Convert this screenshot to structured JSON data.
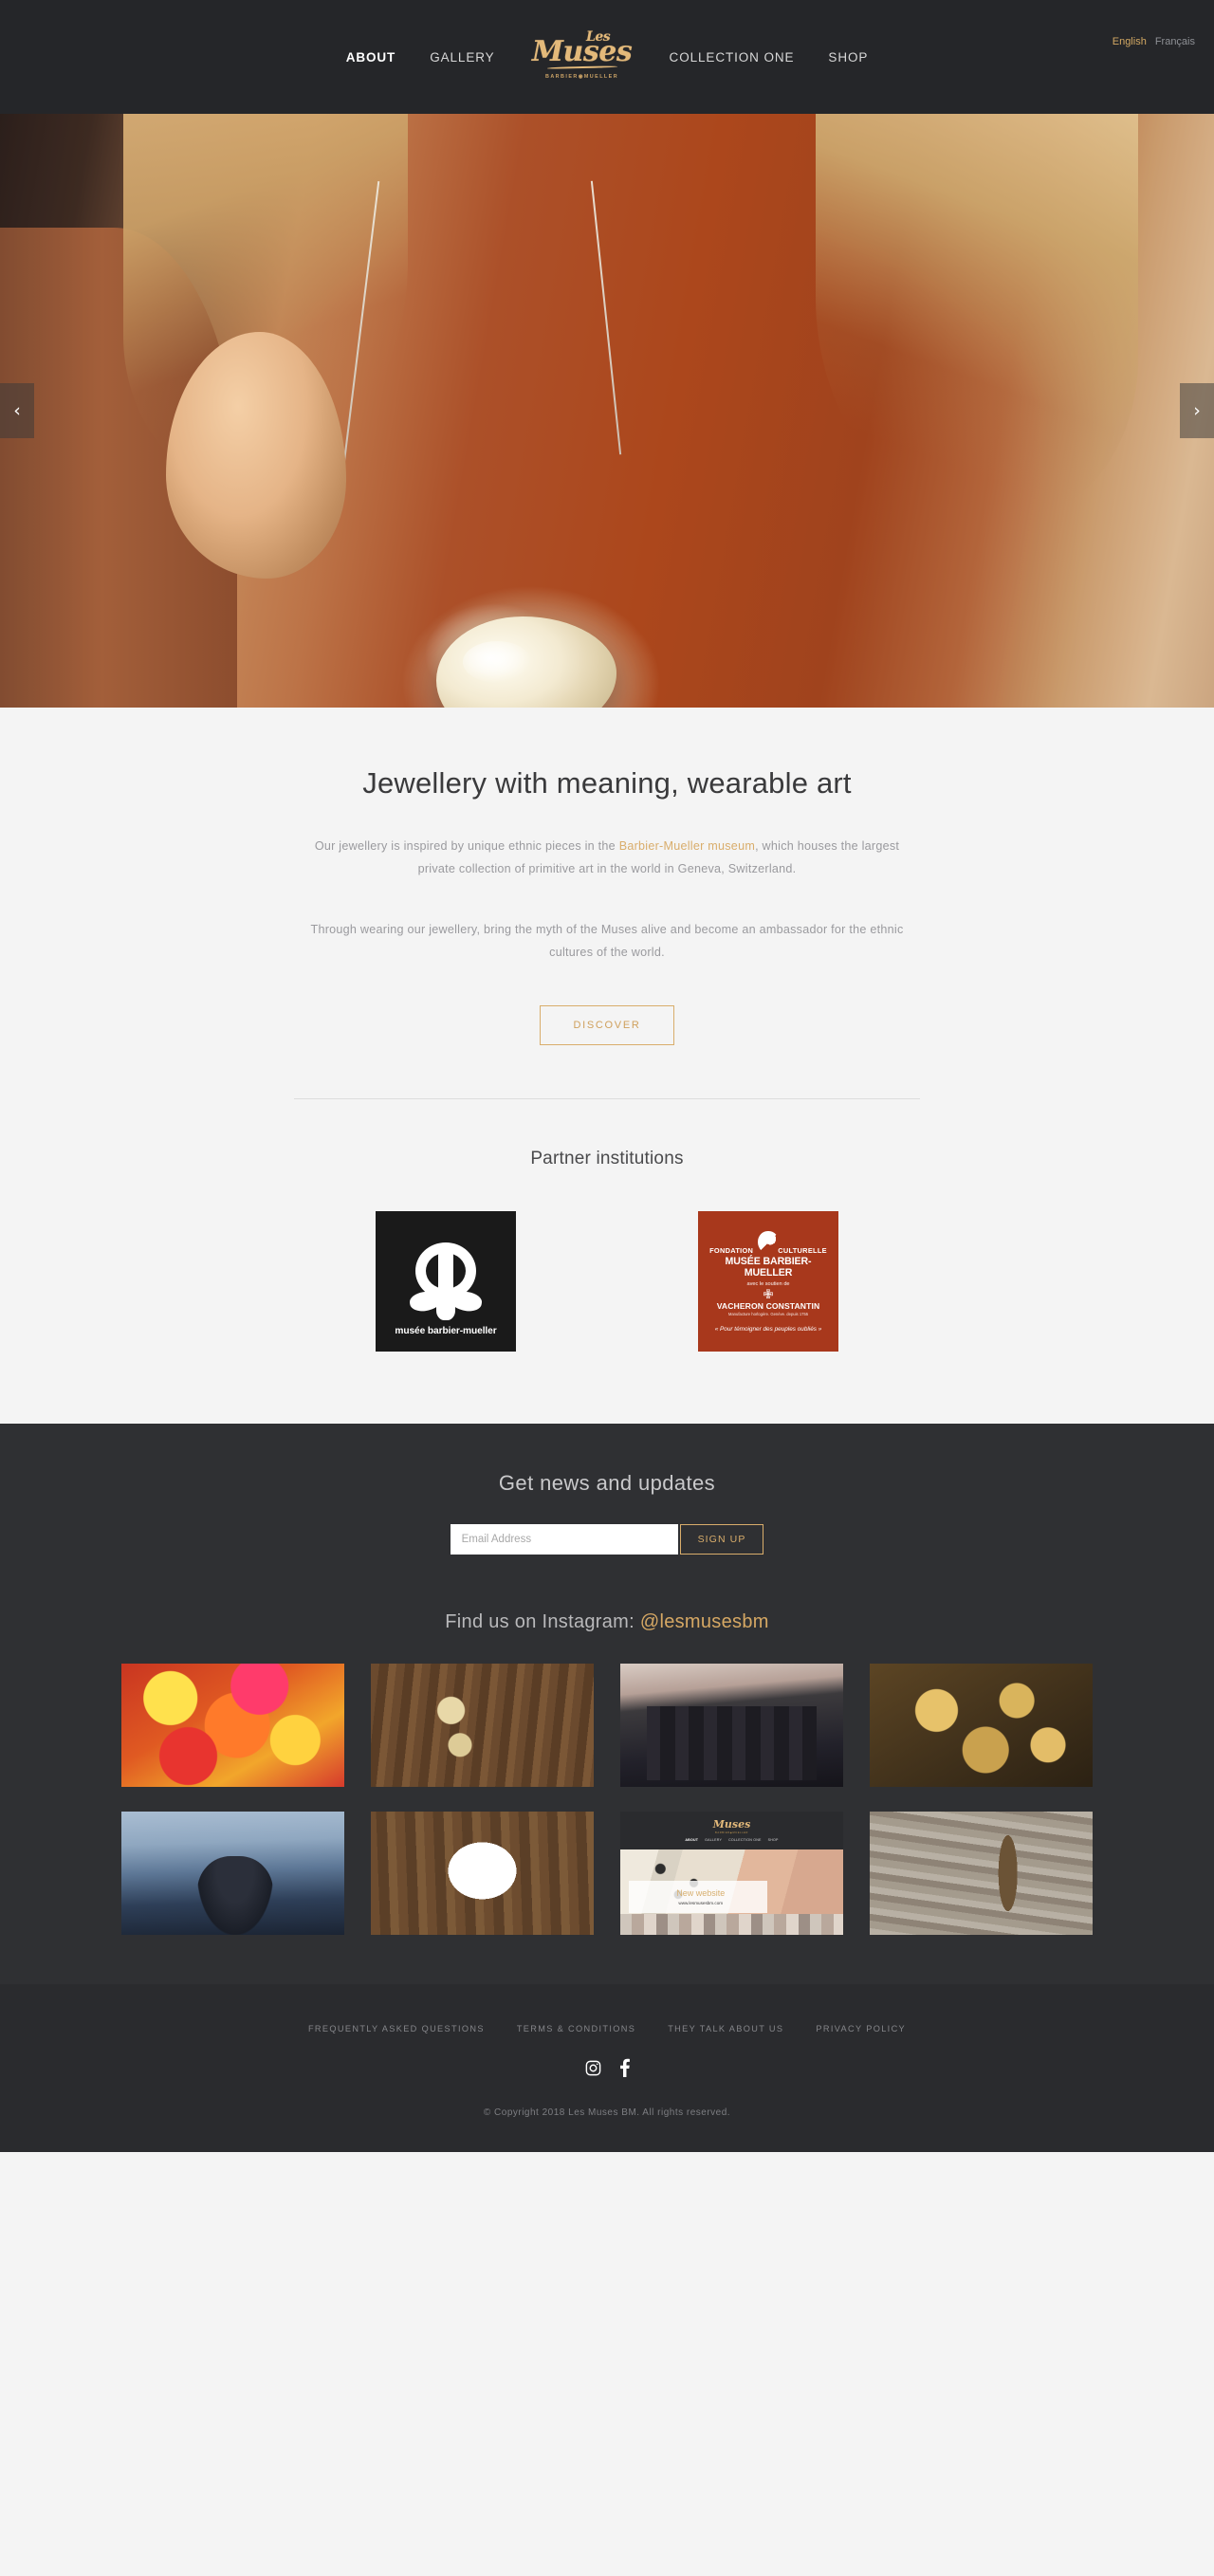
{
  "header": {
    "nav_left": [
      {
        "label": "ABOUT",
        "active": true
      },
      {
        "label": "GALLERY",
        "active": false
      }
    ],
    "nav_right": [
      {
        "label": "COLLECTION ONE",
        "active": false
      },
      {
        "label": "SHOP",
        "active": false
      }
    ],
    "logo": {
      "script_small": "Les",
      "script_main": "Muses",
      "subtitle": "BARBIER◉MUELLER"
    },
    "languages": [
      {
        "label": "English",
        "active": true
      },
      {
        "label": "Français",
        "active": false
      }
    ],
    "bg_color": "#252629",
    "gold": "#d9ad6b"
  },
  "hero": {
    "prev_arrow": "‹",
    "next_arrow": "›",
    "alt": "Woman in rust-coloured top wearing a large mother-of-pearl pendant on a silver chain"
  },
  "intro": {
    "heading": "Jewellery with meaning, wearable art",
    "paragraph1_before": "Our jewellery is inspired by unique ethnic pieces in the ",
    "paragraph1_link": "Barbier-Mueller museum",
    "paragraph1_after": ", which houses the largest private collection of primitive art in the world in Geneva, Switzerland.",
    "paragraph2": "Through wearing our jewellery, bring the myth of the Muses alive and become an ambassador for the ethnic cultures of the world.",
    "discover_label": "DISCOVER"
  },
  "partners": {
    "title": "Partner institutions",
    "logo_mbm": {
      "caption": "musée barbier-mueller",
      "bg": "#1a1a1a"
    },
    "logo_fondation": {
      "line1_left": "FONDATION",
      "line1_right": "CULTURELLE",
      "line2": "MUSÉE BARBIER-MUELLER",
      "line3": "avec le soutien de",
      "cross": "✙",
      "line4": "VACHERON CONSTANTIN",
      "line5": "Manufacture horlogère. Genève. depuis 1755",
      "line6": "« Pour témoigner des peuples oubliés »",
      "bg": "#a8381c"
    }
  },
  "newsletter": {
    "heading": "Get news and updates",
    "email_placeholder": "Email Address",
    "email_value": "",
    "signup_label": "SIGN UP"
  },
  "instagram": {
    "heading_prefix": "Find us on Instagram: ",
    "handle": "@lesmusesbm",
    "tiles": [
      {
        "name": "coloured-pigment-powders",
        "alt": "Bright pink and yellow pigment powders"
      },
      {
        "name": "gold-pendants-on-wood",
        "alt": "Two gold crescent pendants hanging on weathered wood"
      },
      {
        "name": "group-photo-event",
        "alt": "Four people posing at an evening event"
      },
      {
        "name": "gold-jewellery-collection",
        "alt": "Collection of gold ethnic jewellery pieces"
      },
      {
        "name": "woman-matterhorn-view",
        "alt": "Woman looking out at the Matterhorn mountain"
      },
      {
        "name": "white-heart-pendant",
        "alt": "White heart-shaped pendant on rustic wood"
      },
      {
        "name": "new-website-announcement",
        "alt": "Screenshot announcing the new website"
      },
      {
        "name": "necklace-on-driftwood",
        "alt": "Silver necklace draped over driftwood"
      }
    ],
    "new_website_tile": {
      "logo_script": "Muses",
      "logo_sub": "BARBIER◉MUELLER",
      "nav": [
        "ABOUT",
        "GALLERY",
        "COLLECTION ONE",
        "SHOP"
      ],
      "banner_title": "New website",
      "banner_url": "www.lesmusesbm.com"
    }
  },
  "footer": {
    "links": [
      "FREQUENTLY ASKED QUESTIONS",
      "TERMS & CONDITIONS",
      "THEY TALK ABOUT US",
      "PRIVACY POLICY"
    ],
    "social": [
      {
        "name": "instagram-icon"
      },
      {
        "name": "facebook-icon"
      }
    ],
    "copyright": "© Copyright 2018 Les Muses BM. All rights reserved."
  }
}
